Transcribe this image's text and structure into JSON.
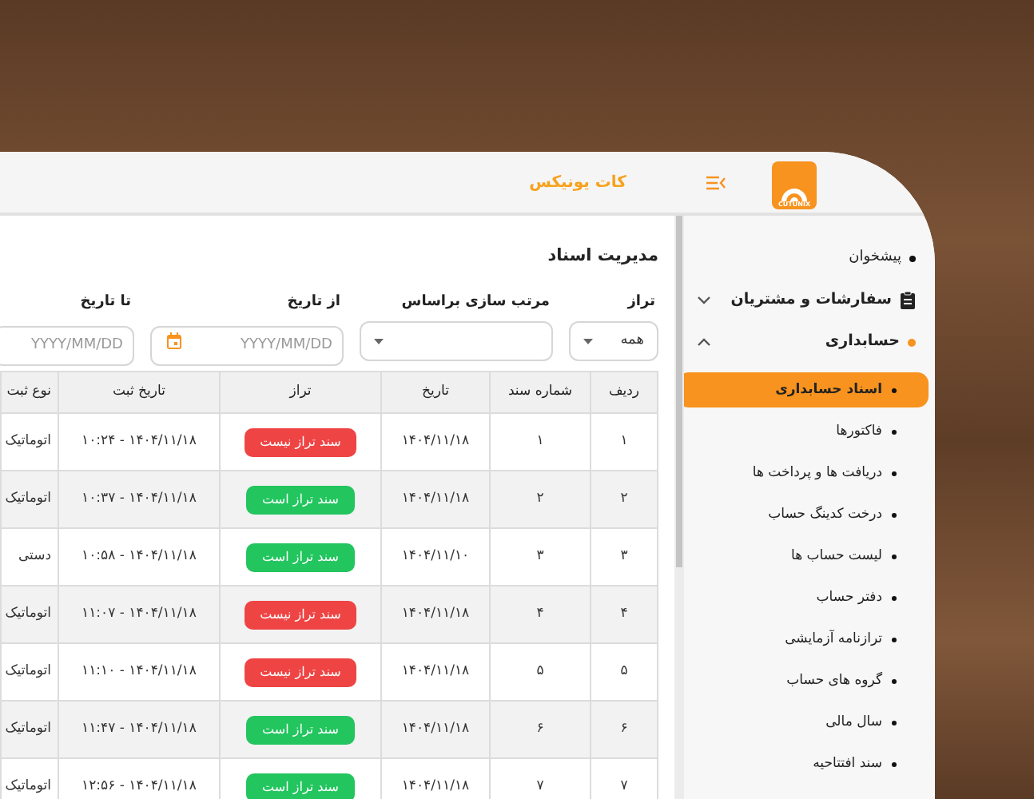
{
  "header": {
    "logo_text": "CUTUNIX",
    "title": "کات یونیکس"
  },
  "sidebar": {
    "items": [
      {
        "label": "پیشخوان",
        "kind": "link"
      },
      {
        "label": "سفارشات و مشتریان",
        "kind": "menu",
        "expanded": false
      },
      {
        "label": "حسابداری",
        "kind": "section",
        "expanded": true,
        "children": [
          {
            "label": "اسناد حسابداری",
            "selected": true
          },
          {
            "label": "فاکتورها",
            "selected": false
          },
          {
            "label": "دریافت ها و پرداخت ها",
            "selected": false
          },
          {
            "label": "درخت کدینگ حساب",
            "selected": false
          },
          {
            "label": "لیست حساب ها",
            "selected": false
          },
          {
            "label": "دفتر حساب",
            "selected": false
          },
          {
            "label": "ترازنامه آزمایشی",
            "selected": false
          },
          {
            "label": "گروه های حساب",
            "selected": false
          },
          {
            "label": "سال مالی",
            "selected": false
          },
          {
            "label": "سند افتتاحیه",
            "selected": false
          }
        ]
      }
    ]
  },
  "page_title": "مدیریت اسناد",
  "filters": [
    {
      "label": "تراز",
      "kind": "select",
      "value": "همه"
    },
    {
      "label": "مرتب سازی براساس",
      "kind": "select"
    },
    {
      "label": "از تاریخ",
      "kind": "date",
      "placeholder": "YYYY/MM/DD",
      "calendar_icon": true
    },
    {
      "label": "تا تاریخ",
      "kind": "date",
      "placeholder": "YYYY/MM/DD",
      "calendar_icon": false
    }
  ],
  "table": {
    "columns": [
      "ردیف",
      "شماره سند",
      "تاریخ",
      "تراز",
      "تاریخ ثبت",
      "نوع ثبت"
    ],
    "rows": [
      {
        "row": "۱",
        "number": "۱",
        "date": "۱۴۰۴/۱۱/۱۸",
        "balanced": false,
        "status": "سند تراز نیست",
        "registered": "۱۴۰۴/۱۱/۱۸ - ۱۰:۲۴",
        "type": "اتوماتیک"
      },
      {
        "row": "۲",
        "number": "۲",
        "date": "۱۴۰۴/۱۱/۱۸",
        "balanced": true,
        "status": "سند تراز است",
        "registered": "۱۴۰۴/۱۱/۱۸ - ۱۰:۳۷",
        "type": "اتوماتیک"
      },
      {
        "row": "۳",
        "number": "۳",
        "date": "۱۴۰۴/۱۱/۱۰",
        "balanced": true,
        "status": "سند تراز است",
        "registered": "۱۴۰۴/۱۱/۱۸ - ۱۰:۵۸",
        "type": "دستی"
      },
      {
        "row": "۴",
        "number": "۴",
        "date": "۱۴۰۴/۱۱/۱۸",
        "balanced": false,
        "status": "سند تراز نیست",
        "registered": "۱۴۰۴/۱۱/۱۸ - ۱۱:۰۷",
        "type": "اتوماتیک"
      },
      {
        "row": "۵",
        "number": "۵",
        "date": "۱۴۰۴/۱۱/۱۸",
        "balanced": false,
        "status": "سند تراز نیست",
        "registered": "۱۴۰۴/۱۱/۱۸ - ۱۱:۱۰",
        "type": "اتوماتیک"
      },
      {
        "row": "۶",
        "number": "۶",
        "date": "۱۴۰۴/۱۱/۱۸",
        "balanced": true,
        "status": "سند تراز است",
        "registered": "۱۴۰۴/۱۱/۱۸ - ۱۱:۴۷",
        "type": "اتوماتیک"
      },
      {
        "row": "۷",
        "number": "۷",
        "date": "۱۴۰۴/۱۱/۱۸",
        "balanced": true,
        "status": "سند تراز است",
        "registered": "۱۴۰۴/۱۱/۱۸ - ۱۲:۵۶",
        "type": "اتوماتیک"
      }
    ]
  }
}
